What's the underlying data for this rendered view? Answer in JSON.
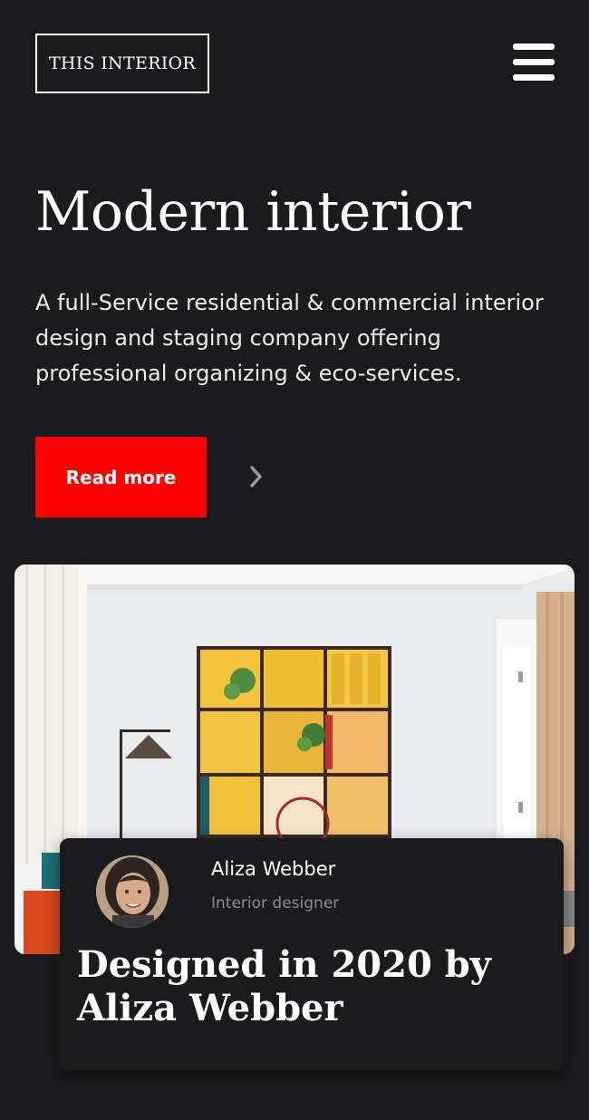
{
  "header": {
    "logo_text": "THIS INTERIOR",
    "menu_icon": "hamburger-menu-icon"
  },
  "hero": {
    "title": "Modern interior",
    "description": "A full-Service residential & commercial interior design and staging company offering professional organizing & eco-services.",
    "cta_label": "Read more",
    "next_icon": "chevron-right-icon"
  },
  "feature": {
    "image": "interior-room-photo",
    "author": {
      "name": "Aliza Webber",
      "role": "Interior designer",
      "avatar": "avatar-photo"
    },
    "title": "Designed in 2020 by Aliza Webber"
  },
  "colors": {
    "background": "#1b1b1d",
    "accent": "#ff0000",
    "text": "#ffffff",
    "muted_text": "#8d8d8f"
  }
}
